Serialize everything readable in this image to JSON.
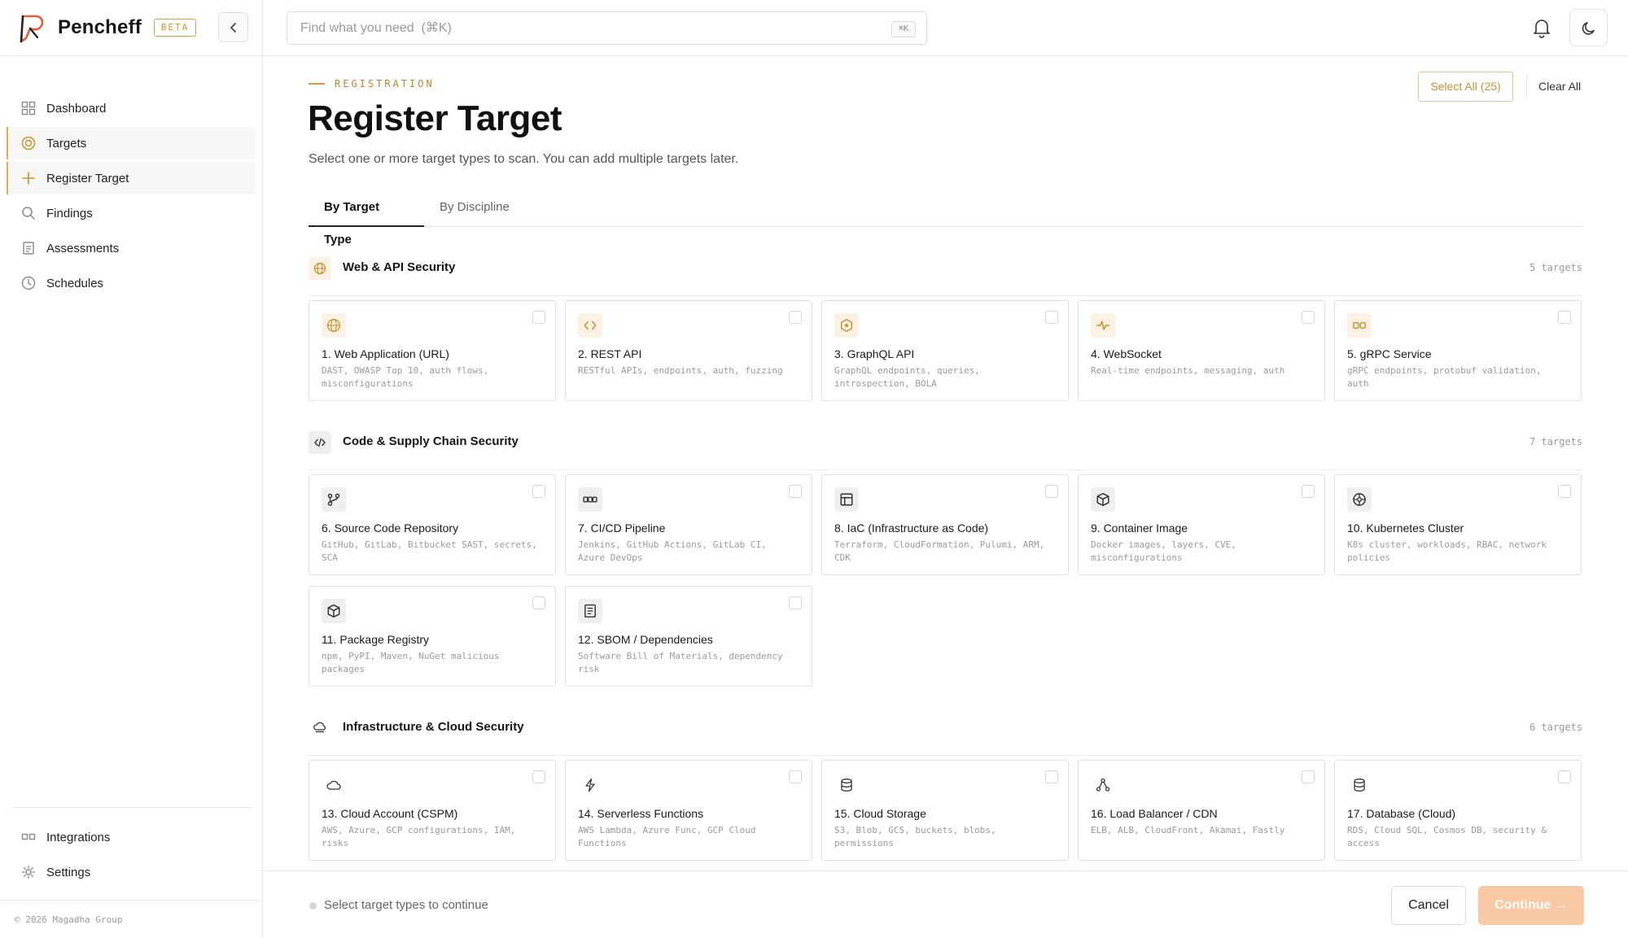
{
  "brand": {
    "name": "Pencheff",
    "badge": "BETA"
  },
  "sidebar": {
    "items": [
      {
        "label": "Dashboard",
        "icon": "grid-icon",
        "active": false
      },
      {
        "label": "Targets",
        "icon": "target-icon",
        "active": true
      },
      {
        "label": "Register Target",
        "icon": "plus-icon",
        "active": true
      },
      {
        "label": "Findings",
        "icon": "search-icon",
        "active": false
      },
      {
        "label": "Assessments",
        "icon": "clipboard-icon",
        "active": false
      },
      {
        "label": "Schedules",
        "icon": "clock-icon",
        "active": false
      }
    ],
    "bottom_items": [
      {
        "label": "Integrations",
        "icon": "link-icon"
      },
      {
        "label": "Settings",
        "icon": "gear-icon"
      }
    ],
    "copyright": "© 2026 Magadha Group"
  },
  "search": {
    "placeholder": "Find what you need  (⌘K)",
    "shortcut": "⌘K"
  },
  "header": {
    "eyebrow": "REGISTRATION",
    "title": "Register Target",
    "subtitle": "Select one or more target types to scan. You can add multiple targets later.",
    "select_all": "Select All (25)",
    "clear_all": "Clear All"
  },
  "tabs": [
    {
      "label": "By Target Type",
      "active": true
    },
    {
      "label": "By Discipline",
      "active": false
    }
  ],
  "sections": [
    {
      "title": "Web & API Security",
      "count": "5 targets",
      "cards": [
        {
          "title": "1. Web Application (URL)",
          "desc": "DAST, OWASP Top 10, auth flows, misconfigurations",
          "icon": "globe-icon"
        },
        {
          "title": "2. REST API",
          "desc": "RESTful APIs, endpoints, auth, fuzzing",
          "icon": "code-brackets-icon"
        },
        {
          "title": "3. GraphQL API",
          "desc": "GraphQL endpoints, queries, introspection, BOLA",
          "icon": "hexagon-icon"
        },
        {
          "title": "4. WebSocket",
          "desc": "Real-time endpoints, messaging, auth",
          "icon": "pulse-icon"
        },
        {
          "title": "5. gRPC Service",
          "desc": "gRPC endpoints, protobuf validation, auth",
          "icon": "link-icon"
        }
      ]
    },
    {
      "title": "Code & Supply Chain Security",
      "count": "7 targets",
      "cards": [
        {
          "title": "6. Source Code Repository",
          "desc": "GitHub, GitLab, Bitbucket SAST, secrets, SCA",
          "icon": "git-branch-icon"
        },
        {
          "title": "7. CI/CD Pipeline",
          "desc": "Jenkins, GitHub Actions, GitLab CI, Azure DevOps",
          "icon": "pipeline-icon"
        },
        {
          "title": "8. IaC (Infrastructure as Code)",
          "desc": "Terraform, CloudFormation, Pulumi, ARM, CDK",
          "icon": "layout-icon"
        },
        {
          "title": "9. Container Image",
          "desc": "Docker images, layers, CVE, misconfigurations",
          "icon": "box-icon"
        },
        {
          "title": "10. Kubernetes Cluster",
          "desc": "K8s cluster, workloads, RBAC, network policies",
          "icon": "helm-icon"
        },
        {
          "title": "11. Package Registry",
          "desc": "npm, PyPI, Maven, NuGet malicious packages",
          "icon": "package-icon"
        },
        {
          "title": "12. SBOM / Dependencies",
          "desc": "Software Bill of Materials, dependency risk",
          "icon": "document-icon"
        }
      ]
    },
    {
      "title": "Infrastructure & Cloud Security",
      "count": "6 targets",
      "cards": [
        {
          "title": "13. Cloud Account (CSPM)",
          "desc": "AWS, Azure, GCP configurations, IAM, risks",
          "icon": "cloud-icon"
        },
        {
          "title": "14. Serverless Functions",
          "desc": "AWS Lambda, Azure Func, GCP Cloud Functions",
          "icon": "lightning-icon"
        },
        {
          "title": "15. Cloud Storage",
          "desc": "S3, Blob, GCS, buckets, blobs, permissions",
          "icon": "storage-icon"
        },
        {
          "title": "16. Load Balancer / CDN",
          "desc": "ELB, ALB, CloudFront, Akamai, Fastly",
          "icon": "network-icon"
        },
        {
          "title": "17. Database (Cloud)",
          "desc": "RDS, Cloud SQL, Cosmos DB, security & access",
          "icon": "database-icon"
        }
      ]
    }
  ],
  "footer": {
    "status": "Select target types to continue",
    "cancel": "Cancel",
    "continue": "Continue →"
  },
  "colors": {
    "accent": "#c9922f",
    "continue_disabled": "#f9c8a4"
  }
}
